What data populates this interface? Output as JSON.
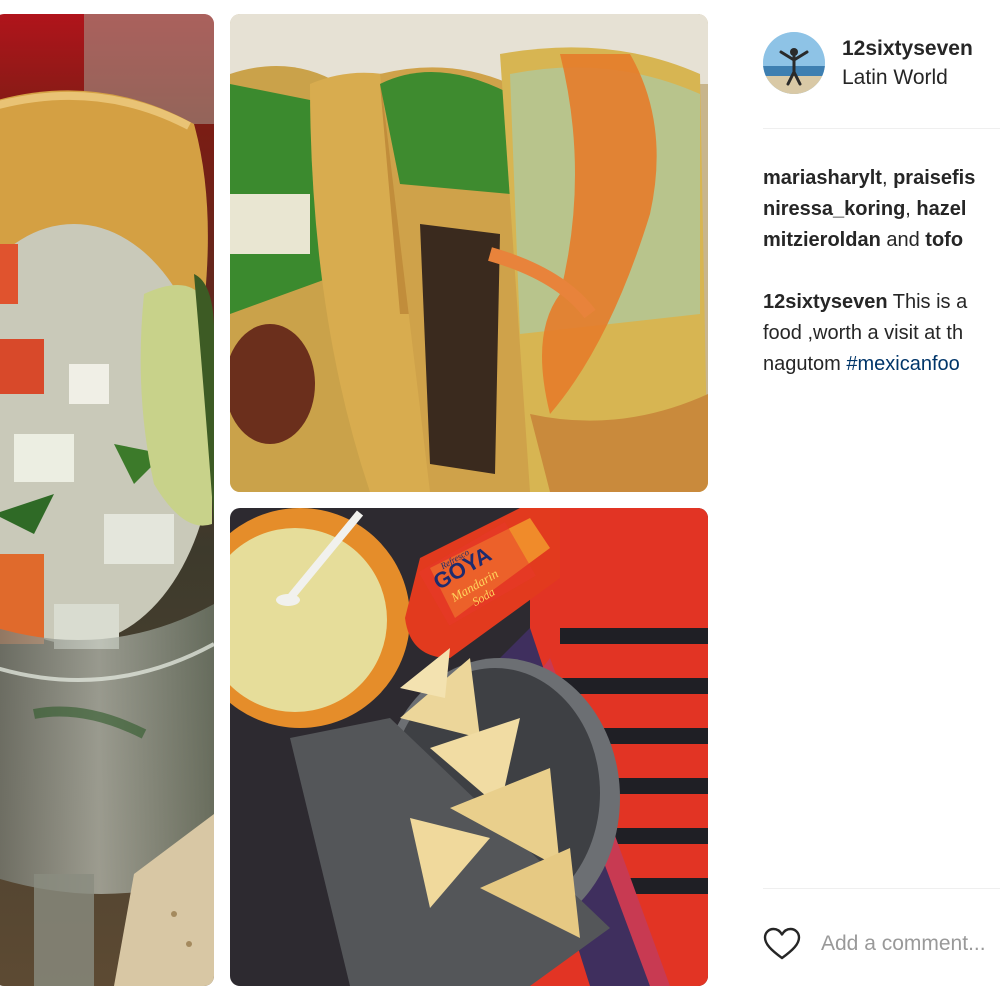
{
  "post": {
    "username": "12sixtyseven",
    "location": "Latin World"
  },
  "likes": {
    "line1": [
      {
        "user": "mariasharylt",
        "sep": ", "
      },
      {
        "user": "praisefis",
        "sep": ""
      }
    ],
    "line2": [
      {
        "user": "niressa_koring",
        "sep": ", "
      },
      {
        "user": "hazel",
        "sep": ""
      }
    ],
    "line3": [
      {
        "user": "mitzieroldan",
        "sep": " and "
      },
      {
        "user": "tofo",
        "sep": ""
      }
    ]
  },
  "caption": {
    "user": "12sixtyseven",
    "line1_text": " This is a",
    "line2_text": "food ,worth a visit at th",
    "line3_text": "nagutom ",
    "hashtag": "#mexicanfoo"
  },
  "comment": {
    "placeholder": "Add a comment..."
  },
  "images": {
    "soda_brand": "GOYA",
    "soda_flavor_top": "Mandarin",
    "soda_flavor_bottom": "Soda",
    "soda_tagline": "Refresco"
  },
  "colors": {
    "text": "#262626",
    "hashtag": "#003569",
    "placeholder": "#999999",
    "divider": "#efefef"
  },
  "icons": {
    "like": "heart-outline-icon",
    "avatar": "person-on-beach-avatar"
  }
}
